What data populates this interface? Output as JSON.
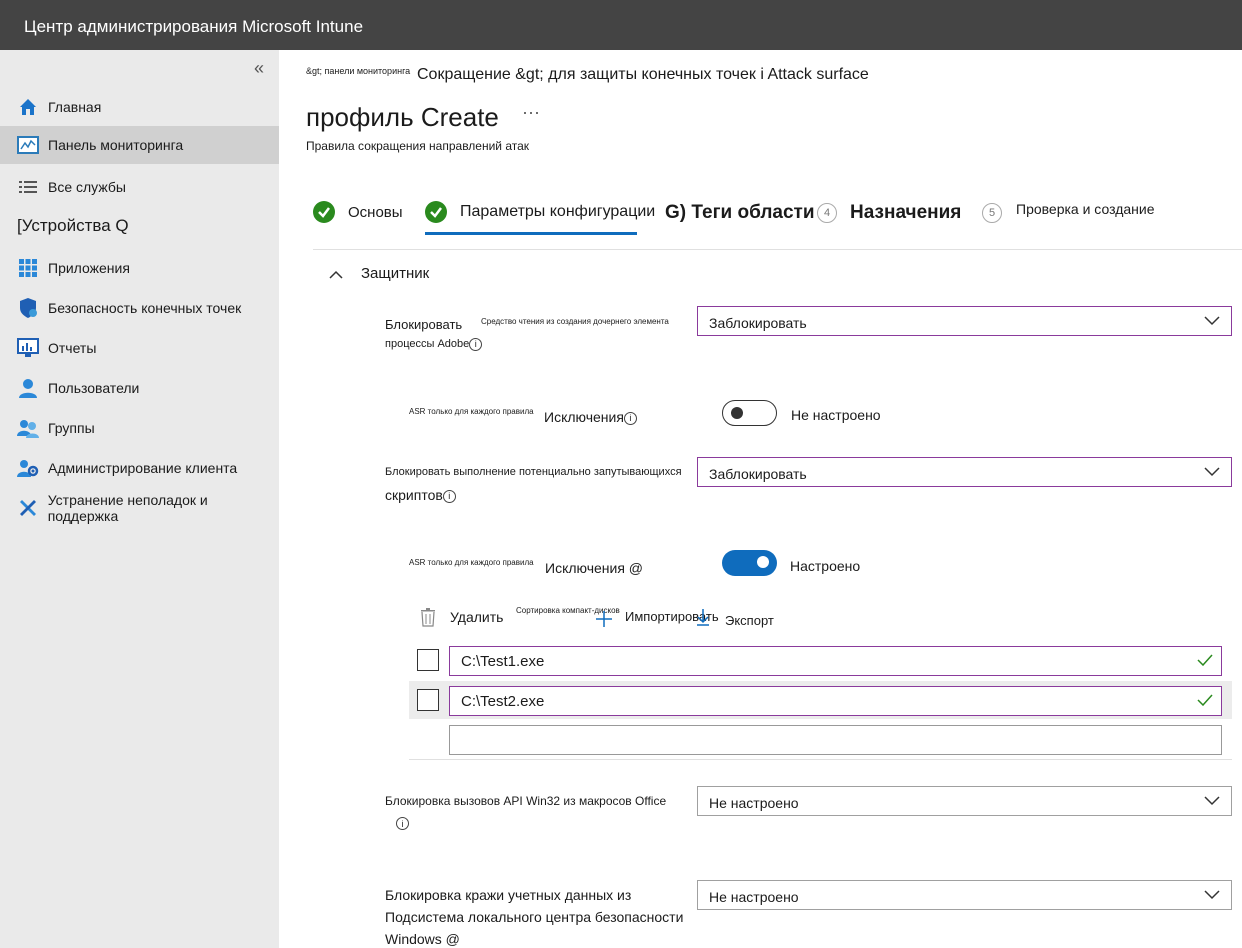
{
  "app": {
    "title": "Центр администрирования Microsoft Intune"
  },
  "sidebar": {
    "collapse": "«",
    "items": [
      {
        "label": "Главная",
        "icon": "home-icon"
      },
      {
        "label": "Панель мониторинга",
        "icon": "dashboard-icon"
      },
      {
        "label": "Все службы",
        "icon": "list-icon"
      },
      {
        "label": "Приложения",
        "icon": "apps-grid-icon"
      },
      {
        "label": "Безопасность конечных точек",
        "icon": "shield-icon"
      },
      {
        "label": "Отчеты",
        "icon": "reports-monitor-icon"
      },
      {
        "label": "Пользователи",
        "icon": "user-icon"
      },
      {
        "label": "Группы",
        "icon": "groups-icon"
      },
      {
        "label": "Администрирование клиента",
        "icon": "tenant-admin-icon"
      },
      {
        "label": "Устранение неполадок и поддержка",
        "icon": "wrench-icon"
      }
    ],
    "section": "[Устройства Q"
  },
  "breadcrumb": {
    "small": "&gt; панели мониторинга",
    "big": "Сокращение &gt; для защиты конечных точек i Attack surface"
  },
  "page": {
    "title": "профиль Create",
    "more": "···",
    "subtitle": "Правила сокращения направлений атак"
  },
  "tabs": [
    {
      "label": "Основы",
      "state": "done"
    },
    {
      "label": "Параметры конфигурации",
      "state": "done-active"
    },
    {
      "label": "G) Теги области",
      "num": "4"
    },
    {
      "label": "Назначения",
      "num": "5"
    },
    {
      "label": "Проверка и создание"
    }
  ],
  "section": {
    "chevron": "^",
    "title": "Защитник"
  },
  "settings": {
    "adobe": {
      "label1": "Блокировать",
      "tiny": "Средство чтения из создания дочернего элемента",
      "label2": "процессы Adobe",
      "info": "i",
      "value": "Заблокировать"
    },
    "excl1": {
      "tiny": "ASR только для каждого правила",
      "label": "Исключения",
      "info": "i",
      "toggle": "Не настроено"
    },
    "scripts": {
      "label1": "Блокировать выполнение потенциально запутывающихся",
      "label2": "скриптов",
      "info": "i",
      "value": "Заблокировать"
    },
    "excl2": {
      "tiny": "ASR только для каждого правила",
      "label": "Исключения @",
      "toggle": "Настроено"
    },
    "toolbar": {
      "delete": "Удалить",
      "sort": "Сортировка компакт-дисков",
      "import": "Импортировать",
      "export": "Экспорт"
    },
    "entries": [
      "C:\\Test1.exe",
      "C:\\Test2.exe",
      ""
    ],
    "win32": {
      "label": "Блокировка вызовов API Win32 из макросов Office",
      "info": "i",
      "value": "Не настроено"
    },
    "lsass": {
      "label1": "Блокировка кражи учетных данных из",
      "label2": "Подсистема локального центра безопасности",
      "label3": "Windows @",
      "value": "Не настроено"
    }
  },
  "colors": {
    "topbar": "#444444",
    "sidebar": "#eaeaea",
    "accent": "#0f6cbd",
    "check": "#2a8a1e",
    "focus": "#8a3a9c"
  }
}
